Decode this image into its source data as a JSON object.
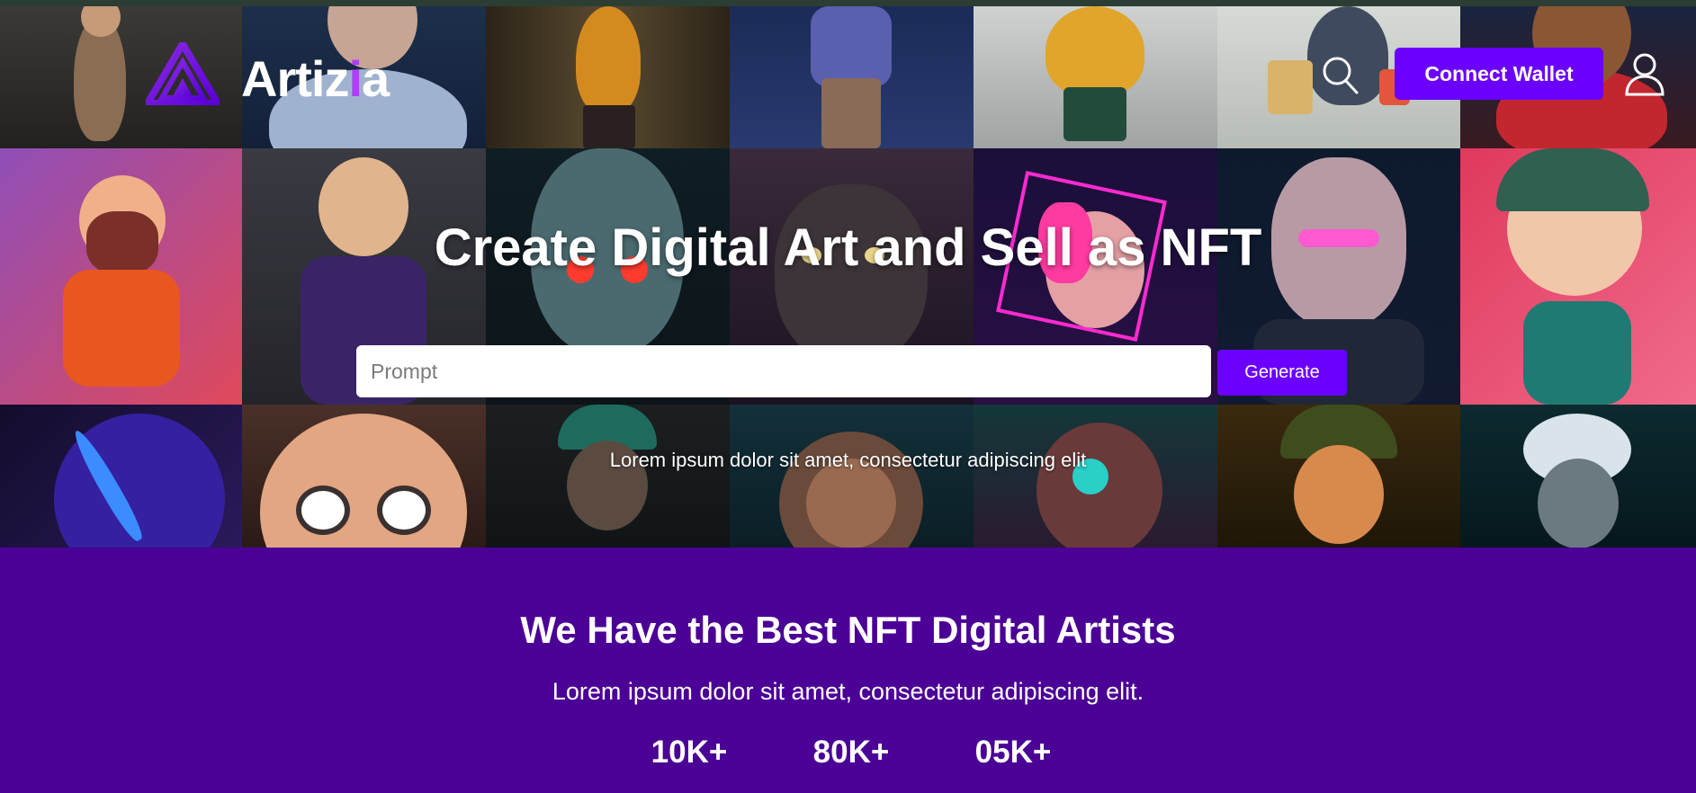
{
  "brand": {
    "name_main": "Artiz",
    "name_dot": "i",
    "name_end": "a",
    "accent": "#6b00ff",
    "section_bg": "#4b0096"
  },
  "header": {
    "search_icon": "search-icon",
    "wallet_label": "Connect Wallet",
    "user_icon": "user-icon"
  },
  "hero": {
    "title": "Create Digital Art and Sell as NFT",
    "prompt_placeholder": "Prompt",
    "generate_label": "Generate",
    "subtitle": "Lorem ipsum dolor sit amet, consectetur adipiscing elit"
  },
  "artists": {
    "title": "We Have the Best NFT Digital Artists",
    "subtitle": "Lorem ipsum dolor sit amet, consectetur adipiscing elit.",
    "stats": [
      "10K+",
      "80K+",
      "05K+"
    ]
  }
}
